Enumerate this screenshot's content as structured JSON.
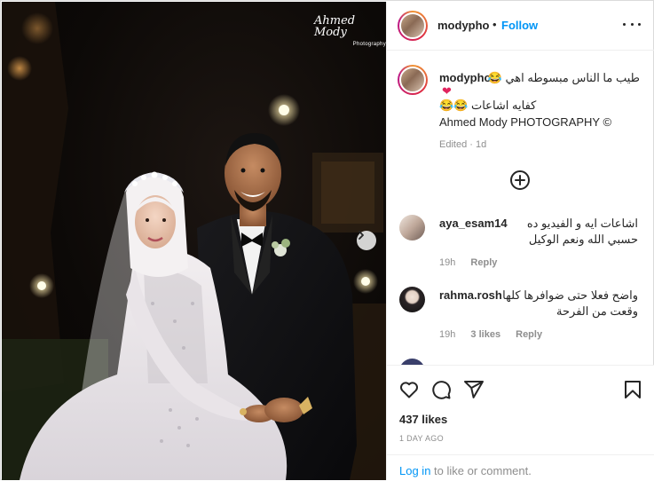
{
  "post": {
    "username": "modypho",
    "follow_label": "Follow",
    "separator": "•",
    "photo_watermark": "Ahmed Mody",
    "photo_watermark_sub": "Photography"
  },
  "caption": {
    "username": "modypho",
    "line1": "طيب ما الناس مبسوطه اهي 😂",
    "heart": "❤",
    "line2": "كفايه اشاعات 😂😂",
    "line3": "Ahmed Mody PHOTOGRAPHY ©",
    "edited": "Edited · 1d"
  },
  "comments": [
    {
      "username": "aya_esam14",
      "text": "اشاعات ايه و الفيديو ده حسبي الله ونعم الوكيل",
      "time": "19h",
      "reply": "Reply"
    },
    {
      "username": "rahma.rosh",
      "text": "واضح فعلا حتى ضوافرها كلها وقعت من الفرحة",
      "time": "19h",
      "likes": "3 likes",
      "reply": "Reply"
    }
  ],
  "footer": {
    "likes": "437 likes",
    "date": "1 DAY AGO",
    "login_link": "Log in",
    "login_rest": " to like or comment."
  },
  "icons": {
    "more": "more-options-icon",
    "add": "add-comment-icon",
    "like": "heart-outline-icon",
    "comment": "comment-icon",
    "share": "share-icon",
    "save": "bookmark-icon",
    "next": "chevron-right-icon"
  },
  "colors": {
    "link": "#0095f6",
    "text": "#262626",
    "muted": "#8e8e8e",
    "border": "#dbdbdb"
  }
}
